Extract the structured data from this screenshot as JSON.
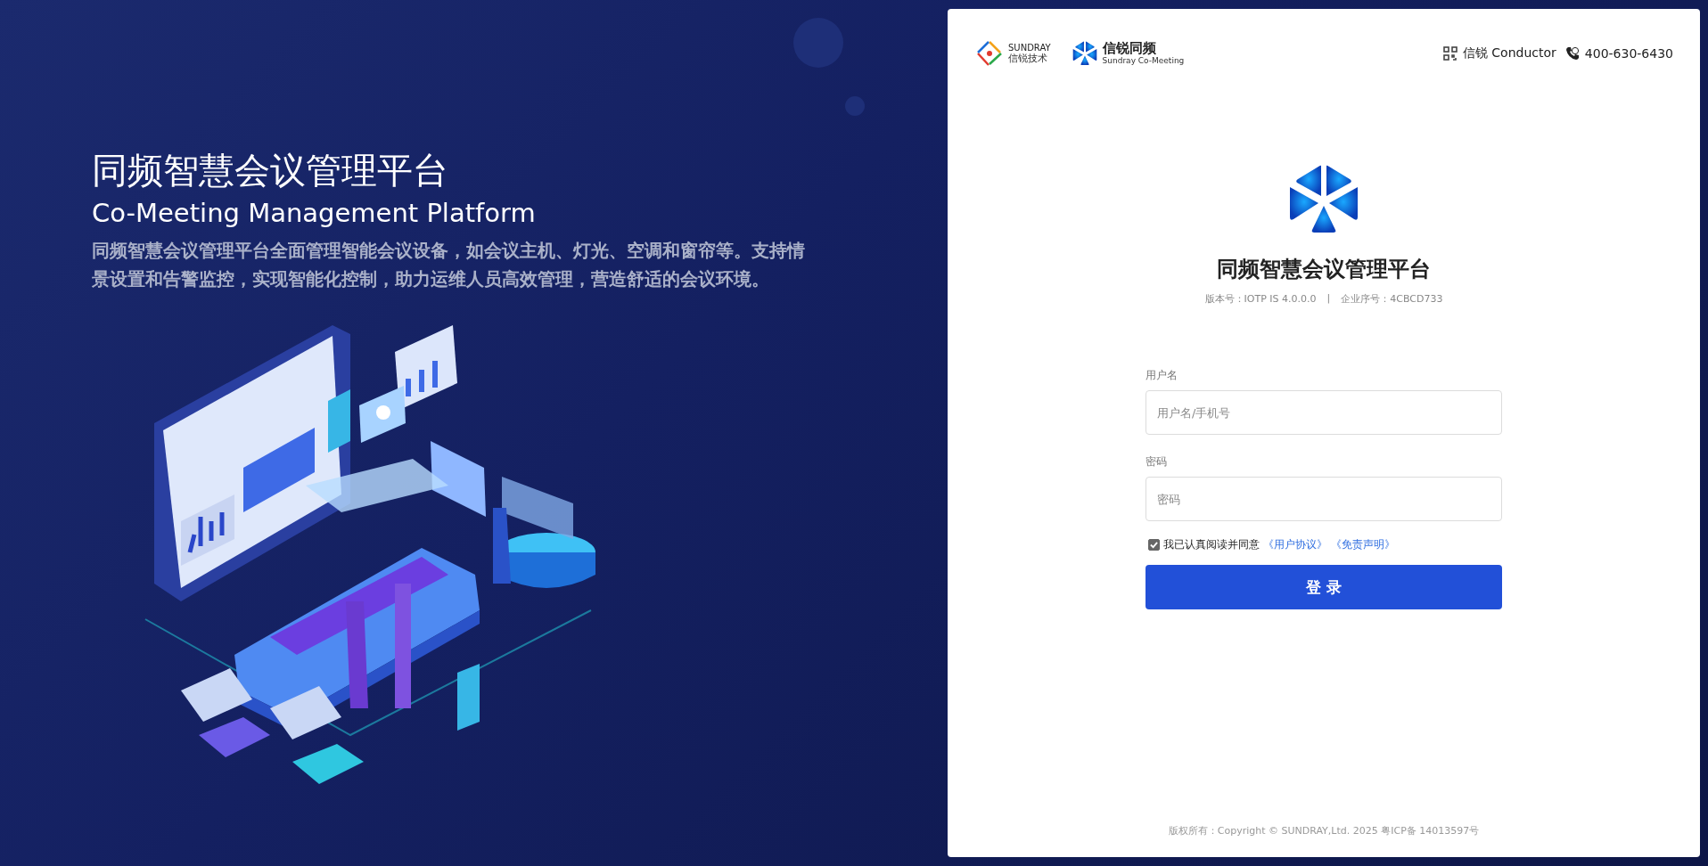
{
  "hero": {
    "title": "同频智慧会议管理平台",
    "subtitle": "Co-Meeting Management Platform",
    "description": "同频智慧会议管理平台全面管理智能会议设备，如会议主机、灯光、空调和窗帘等。支持情景设置和告警监控，实现智能化控制，助力运维人员高效管理，营造舒适的会议环境。"
  },
  "header": {
    "brand_logos": [
      {
        "name": "SUNDRAY",
        "caption": "信锐技术"
      },
      {
        "name": "信锐同频",
        "caption": "Sundray Co-Meeting"
      }
    ],
    "links": [
      {
        "kind": "qr",
        "label": "信锐 Conductor"
      },
      {
        "kind": "phone",
        "label": "400-630-6430"
      }
    ]
  },
  "login": {
    "title": "同频智慧会议管理平台",
    "version": "版本号：IOTP IS 4.0.0.0",
    "separator": "|",
    "serial": "企业序号：4CBCD733",
    "fields": [
      {
        "label": "用户名",
        "placeholder": "用户名/手机号"
      },
      {
        "label": "密码",
        "placeholder": "密码"
      }
    ],
    "agreement": {
      "checked": true,
      "text": "我已认真阅读并同意",
      "links": [
        "《用户协议》",
        "《免责声明》"
      ]
    },
    "submit": "登 录"
  },
  "footer": "版权所有：Copyright © SUNDRAY,Ltd. 2025 粤ICP备 14013597号"
}
